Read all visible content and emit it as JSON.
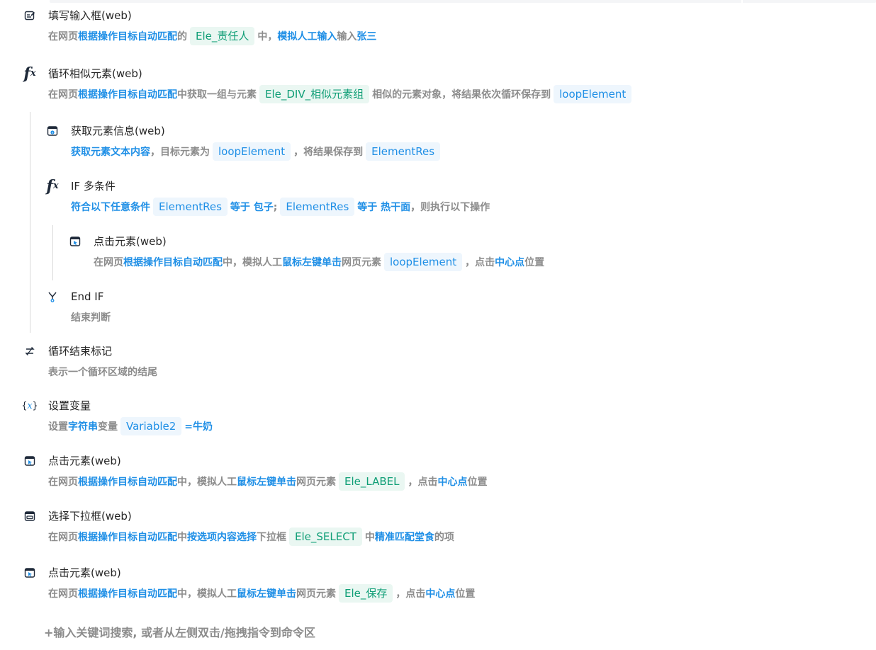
{
  "steps": {
    "fill_input": {
      "title": "填写输入框(web)",
      "d1": "在网页",
      "d2": "根据操作目标自动匹配",
      "d3": "的",
      "chip": "Ele_责任人",
      "d4": "中，",
      "d5": "模拟人工输入",
      "d6": "输入",
      "d7": "张三"
    },
    "loop_similar": {
      "title": "循环相似元素(web)",
      "d1": "在网页",
      "d2": "根据操作目标自动匹配",
      "d3": "中获取一组与元素",
      "chip1": "Ele_DIV_相似元素组",
      "d4": "相似的元素对象，将结果依次循环保存到",
      "chip2": "loopElement"
    },
    "get_info": {
      "title": "获取元素信息(web)",
      "d1": "获取元素文本内容",
      "d2": "，目标元素为",
      "chip1": "loopElement",
      "d3": "，将结果保存到",
      "chip2": "ElementRes"
    },
    "if_multi": {
      "title": "IF 多条件",
      "d1": "符合以下任意条件",
      "chip1": "ElementRes",
      "d2": "等于",
      "d3": "包子",
      "d4": ";",
      "chip2": "ElementRes",
      "d5": "等于",
      "d6": "热干面",
      "d7": "，则执行以下操作"
    },
    "click_inner": {
      "title": "点击元素(web)",
      "d1": "在网页",
      "d2": "根据操作目标自动匹配",
      "d3": "中，模拟人工",
      "d4": "鼠标左键单击",
      "d5": "网页元素",
      "chip": "loopElement",
      "d6": "，点击",
      "d7": "中心点",
      "d8": "位置"
    },
    "end_if": {
      "title": "End IF",
      "desc": "结束判断"
    },
    "loop_end": {
      "title": "循环结束标记",
      "desc": "表示一个循环区域的结尾"
    },
    "set_var": {
      "title": "设置变量",
      "d1": "设置",
      "d2": "字符串",
      "d3": "变量",
      "chip": "Variable2",
      "d4": "=",
      "d5": "牛奶"
    },
    "click_label": {
      "title": "点击元素(web)",
      "d1": "在网页",
      "d2": "根据操作目标自动匹配",
      "d3": "中，模拟人工",
      "d4": "鼠标左键单击",
      "d5": "网页元素",
      "chip": "Ele_LABEL",
      "d6": "，点击",
      "d7": "中心点",
      "d8": "位置"
    },
    "select_dropdown": {
      "title": "选择下拉框(web)",
      "d1": "在网页",
      "d2": "根据操作目标自动匹配",
      "d3": "中",
      "d4": "按选项内容选择",
      "d5": "下拉框",
      "chip": "Ele_SELECT",
      "d6": "中",
      "d7": "精准匹配",
      "d8": "堂食",
      "d9": "的项"
    },
    "click_save": {
      "title": "点击元素(web)",
      "d1": "在网页",
      "d2": "根据操作目标自动匹配",
      "d3": "中，模拟人工",
      "d4": "鼠标左键单击",
      "d5": "网页元素",
      "chip": "Ele_保存",
      "d6": "，点击",
      "d7": "中心点",
      "d8": "位置"
    }
  },
  "footer": {
    "hint": "+输入关键词搜索, 或者从左侧双击/拖拽指令到命令区"
  },
  "icons": [
    "edit-input-icon",
    "fx-function-icon",
    "browser-info-icon",
    "browser-click-icon",
    "merge-branch-icon",
    "loop-end-icon",
    "variable-braces-icon",
    "dropdown-select-icon"
  ],
  "colors": {
    "accent_blue": "#1f8fe6",
    "element_green": "#0f9e76",
    "muted_text": "#8c8c8c"
  }
}
